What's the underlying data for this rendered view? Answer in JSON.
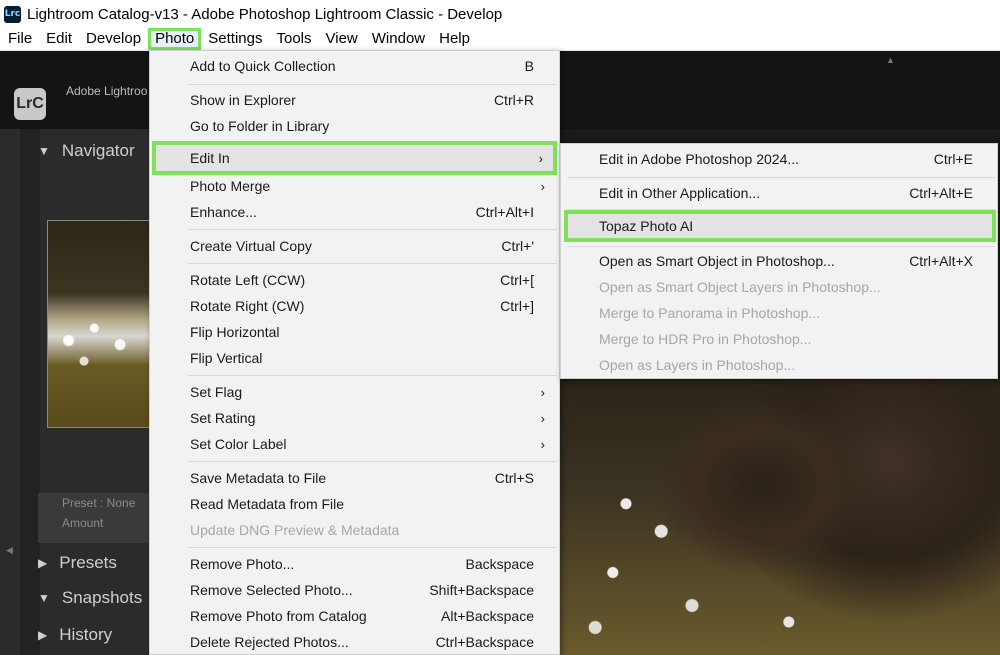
{
  "window": {
    "app_icon": "Lrc",
    "title": "Lightroom Catalog-v13 - Adobe Photoshop Lightroom Classic - Develop"
  },
  "menubar": [
    "File",
    "Edit",
    "Develop",
    "Photo",
    "Settings",
    "Tools",
    "View",
    "Window",
    "Help"
  ],
  "active_menu": "Photo",
  "app": {
    "badge": "LrC",
    "catalog_text": "Adobe Lightroo"
  },
  "left_panel": {
    "navigator": "Navigator",
    "preset_label": "Preset :  None",
    "amount_label": "Amount",
    "presets": "Presets",
    "snapshots": "Snapshots",
    "history": "History"
  },
  "photo_menu": {
    "items": [
      {
        "label": "Add to Quick Collection",
        "shortcut": "B"
      },
      {
        "label": "Show in Explorer",
        "shortcut": "Ctrl+R"
      },
      {
        "label": "Go to Folder in Library",
        "shortcut": ""
      },
      {
        "label": "Edit In",
        "shortcut": "",
        "submenu": true,
        "highlighted": true
      },
      {
        "label": "Photo Merge",
        "shortcut": "",
        "submenu": true
      },
      {
        "label": "Enhance...",
        "shortcut": "Ctrl+Alt+I"
      },
      {
        "label": "Create Virtual Copy",
        "shortcut": "Ctrl+'"
      },
      {
        "label": "Rotate Left (CCW)",
        "shortcut": "Ctrl+["
      },
      {
        "label": "Rotate Right (CW)",
        "shortcut": "Ctrl+]"
      },
      {
        "label": "Flip Horizontal",
        "shortcut": ""
      },
      {
        "label": "Flip Vertical",
        "shortcut": ""
      },
      {
        "label": "Set Flag",
        "shortcut": "",
        "submenu": true
      },
      {
        "label": "Set Rating",
        "shortcut": "",
        "submenu": true
      },
      {
        "label": "Set Color Label",
        "shortcut": "",
        "submenu": true
      },
      {
        "label": "Save Metadata to File",
        "shortcut": "Ctrl+S"
      },
      {
        "label": "Read Metadata from File",
        "shortcut": ""
      },
      {
        "label": "Update DNG Preview & Metadata",
        "shortcut": "",
        "disabled": true
      },
      {
        "label": "Remove Photo...",
        "shortcut": "Backspace"
      },
      {
        "label": "Remove Selected Photo...",
        "shortcut": "Shift+Backspace"
      },
      {
        "label": "Remove Photo from Catalog",
        "shortcut": "Alt+Backspace"
      },
      {
        "label": "Delete Rejected Photos...",
        "shortcut": "Ctrl+Backspace"
      }
    ]
  },
  "edit_in_submenu": {
    "items": [
      {
        "label": "Edit in Adobe Photoshop 2024...",
        "shortcut": "Ctrl+E"
      },
      {
        "label": "Edit in Other Application...",
        "shortcut": "Ctrl+Alt+E"
      },
      {
        "label": "Topaz Photo AI",
        "shortcut": "",
        "highlighted": true
      },
      {
        "label": "Open as Smart Object in Photoshop...",
        "shortcut": "Ctrl+Alt+X"
      },
      {
        "label": "Open as Smart Object Layers in Photoshop...",
        "shortcut": "",
        "disabled": true
      },
      {
        "label": "Merge to Panorama in Photoshop...",
        "shortcut": "",
        "disabled": true
      },
      {
        "label": "Merge to HDR Pro in Photoshop...",
        "shortcut": "",
        "disabled": true
      },
      {
        "label": "Open as Layers in Photoshop...",
        "shortcut": "",
        "disabled": true
      }
    ]
  },
  "icons": {
    "submenu_arrow": "›",
    "triangle_down": "▼",
    "triangle_right": "▶",
    "scroll_up": "▲",
    "collapse_left": "◀"
  },
  "colors": {
    "highlight_outline": "#7ee05b",
    "menu_bg": "#f2f2f2",
    "hover_bg": "#e3e3e3"
  }
}
